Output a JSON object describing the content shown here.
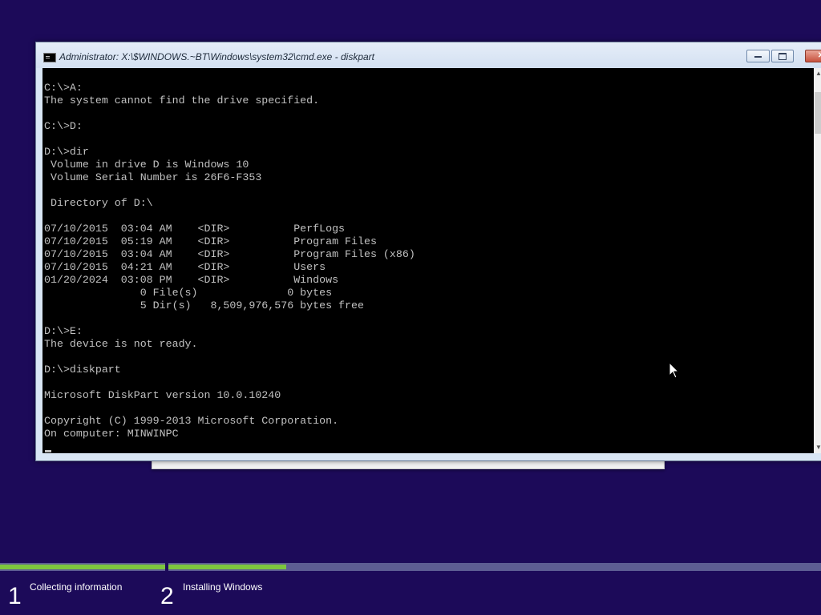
{
  "window": {
    "title": "Administrator: X:\\$WINDOWS.~BT\\Windows\\system32\\cmd.exe - diskpart",
    "icon": "cmd-icon",
    "minimize_icon": "minimize-icon",
    "maximize_icon": "maximize-icon",
    "close_icon": "close-icon",
    "close_label": "✕"
  },
  "console": {
    "lines": [
      "C:\\>A:",
      "The system cannot find the drive specified.",
      "",
      "C:\\>D:",
      "",
      "D:\\>dir",
      " Volume in drive D is Windows 10",
      " Volume Serial Number is 26F6-F353",
      "",
      " Directory of D:\\",
      "",
      "07/10/2015  03:04 AM    <DIR>          PerfLogs",
      "07/10/2015  05:19 AM    <DIR>          Program Files",
      "07/10/2015  03:04 AM    <DIR>          Program Files (x86)",
      "07/10/2015  04:21 AM    <DIR>          Users",
      "01/20/2024  03:08 PM    <DIR>          Windows",
      "               0 File(s)              0 bytes",
      "               5 Dir(s)   8,509,976,576 bytes free",
      "",
      "D:\\>E:",
      "The device is not ready.",
      "",
      "D:\\>diskpart",
      "",
      "Microsoft DiskPart version 10.0.10240",
      "",
      "Copyright (C) 1999-2013 Microsoft Corporation.",
      "On computer: MINWINPC"
    ],
    "colors": {
      "background": "#000000",
      "text": "#c0c0c0"
    }
  },
  "setup": {
    "steps": [
      {
        "number": "1",
        "label": "Collecting information",
        "progress": 1.0
      },
      {
        "number": "2",
        "label": "Installing Windows",
        "progress": 0.18
      }
    ],
    "colors": {
      "background": "#1c0a59",
      "progress_fill": "#7dc63e",
      "progress_track": "#5d5d93"
    }
  },
  "pointer": {
    "icon": "mouse-pointer-icon"
  }
}
